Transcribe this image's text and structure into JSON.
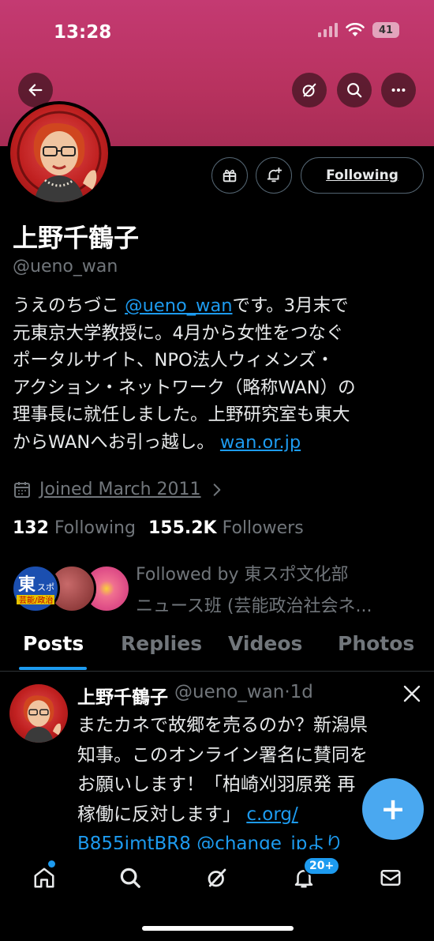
{
  "status_bar": {
    "time": "13:28",
    "battery": "41"
  },
  "header": {
    "back_icon": "arrow-left-icon",
    "grok_icon": "grok-icon",
    "search_icon": "search-icon",
    "more_icon": "more-icon",
    "banner_color": "#c43a72"
  },
  "profile": {
    "display_name": "上野千鶴子",
    "handle": "@ueno_wan",
    "following_button": "Following",
    "bio": {
      "line1_pre": "うえのちづこ ",
      "line1_mention": "@ueno_wan",
      "line1_post": "です。3月末で",
      "line2": "元東京大学教授に。4月から女性をつなぐ",
      "line3": "ポータルサイト、NPO法人ウィメンズ・",
      "line4": "アクション・ネットワーク（略称WAN）の",
      "line5": "理事長に就任しました。上野研究室も東大",
      "line6_pre": "からWANへお引っ越し。 ",
      "line6_link": "wan.or.jp"
    },
    "joined": "Joined March 2011",
    "following_count": "132",
    "following_label": "Following",
    "followers_count": "155.2K",
    "followers_label": "Followers",
    "followed_by": {
      "line1": "Followed by 東スポ文化部",
      "line2": "ニュース班 (芸能政治社会ネ..."
    }
  },
  "tabs": [
    "Posts",
    "Replies",
    "Videos",
    "Photos"
  ],
  "tweet": {
    "name": "上野千鶴子",
    "handle": "@ueno_wan",
    "sep": "·",
    "time": "1d",
    "line1": "またカネで故郷を売るのか？新潟県",
    "line2": "知事。このオンライン署名に賛同を",
    "line3": "お願いします！「柏崎刈羽原発 再",
    "line4_pre": "稼働に反対します」 ",
    "line4_link": "c.org/",
    "line5": "B855imtBR8 @change_jpより"
  },
  "fab": "+",
  "bottom_nav": {
    "notifications_badge": "20+",
    "items": [
      "home-icon",
      "search-icon",
      "grok-icon",
      "notifications-icon",
      "messages-icon"
    ]
  },
  "colors": {
    "accent": "#1d9bf0",
    "muted": "#71767b",
    "background": "#000000"
  }
}
